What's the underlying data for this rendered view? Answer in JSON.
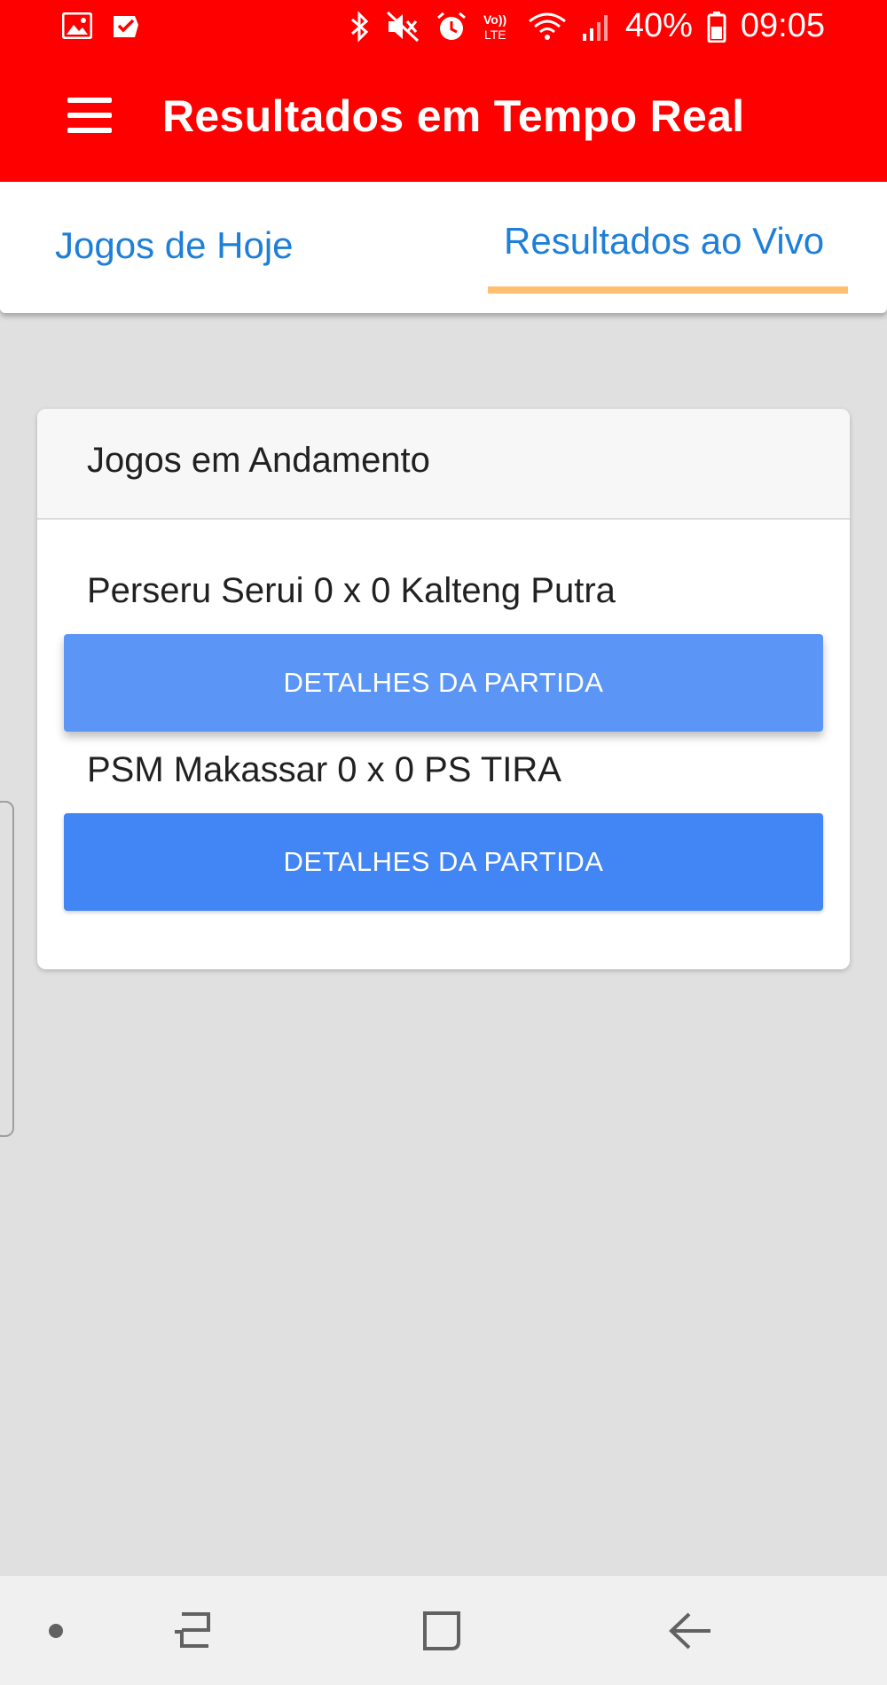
{
  "status_bar": {
    "battery": "40%",
    "time": "09:05",
    "volte": "Vo)) LTE",
    "left_icons": [
      "gallery-icon",
      "check-message-icon"
    ],
    "right_icons": [
      "bluetooth-icon",
      "mute-icon",
      "alarm-icon",
      "volte-icon",
      "wifi-icon",
      "signal-icon",
      "battery-icon"
    ]
  },
  "app_bar": {
    "title": "Resultados em Tempo Real",
    "menu_icon": "hamburger-menu-icon",
    "color": "#ff0000"
  },
  "tabs": [
    {
      "label": "Jogos de Hoje",
      "selected": false
    },
    {
      "label": "Resultados ao Vivo",
      "selected": true
    }
  ],
  "colors": {
    "tab_text": "#1e7fd8",
    "tab_indicator": "#ffbf6e",
    "button_primary": "#4285f4",
    "button_pressed": "#5b95f5",
    "background": "#e0e0e0"
  },
  "card": {
    "title": "Jogos em Andamento",
    "matches": [
      {
        "text": "Perseru Serui 0 x 0 Kalteng Putra",
        "button_label": "DETALHES DA PARTIDA"
      },
      {
        "text": "PSM Makassar 0 x 0 PS TIRA",
        "button_label": "DETALHES DA PARTIDA"
      }
    ]
  },
  "nav_bar": {
    "icons": [
      "dot-icon",
      "recent-apps-icon",
      "home-icon",
      "back-icon"
    ]
  }
}
